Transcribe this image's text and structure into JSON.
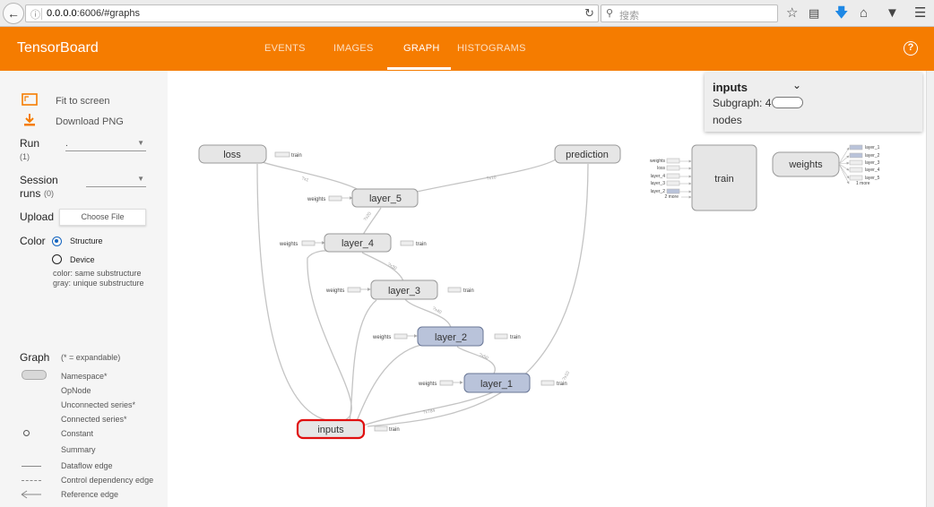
{
  "browser": {
    "url_host": "0.0.0.0",
    "url_rest": ":6006/#graphs",
    "search_placeholder": "搜索"
  },
  "header": {
    "title": "TensorBoard",
    "tabs": [
      {
        "label": "EVENTS"
      },
      {
        "label": "IMAGES"
      },
      {
        "label": "GRAPH"
      },
      {
        "label": "HISTOGRAMS"
      }
    ],
    "active_tab": "GRAPH",
    "help": "?"
  },
  "sidebar": {
    "fit_label": "Fit to screen",
    "download_label": "Download PNG",
    "run_label": "Run",
    "run_count": "(1)",
    "run_value": ".",
    "session_label_1": "Session",
    "session_label_2": "runs",
    "session_count": "(0)",
    "upload_label": "Upload",
    "choose_file": "Choose File",
    "color_label": "Color",
    "color_structure": "Structure",
    "color_device": "Device",
    "color_note_1": "color: same substructure",
    "color_note_2": "gray: unique substructure",
    "graph_label": "Graph",
    "graph_note": "(* = expandable)",
    "legend": [
      "Namespace*",
      "OpNode",
      "Unconnected series*",
      "Connected series*",
      "Constant",
      "Summary",
      "Dataflow edge",
      "Control dependency edge",
      "Reference edge"
    ]
  },
  "infocard": {
    "name": "inputs",
    "subgraph_label": "Subgraph: 4",
    "nodes_label": "nodes"
  },
  "graph": {
    "nodes": {
      "loss": "loss",
      "prediction": "prediction",
      "layer_5": "layer_5",
      "layer_4": "layer_4",
      "layer_3": "layer_3",
      "layer_2": "layer_2",
      "layer_1": "layer_1",
      "inputs": "inputs",
      "train": "train",
      "weights": "weights"
    },
    "aux_labels": {
      "weights": "weights",
      "train": "train"
    },
    "train_inputs": [
      "weights",
      "loss",
      "layer_4",
      "layer_3",
      "layer_2",
      "2 more"
    ],
    "weights_outputs": [
      "layer_1",
      "layer_2",
      "layer_3",
      "layer_4",
      "layer_5",
      "1 more"
    ],
    "edge_labels": [
      "?x1",
      "?x10",
      "?x20",
      "?x30",
      "?x40",
      "?x50",
      "?x784",
      "?x10"
    ]
  },
  "colors": {
    "accent": "#f57c00",
    "node_gray": "#e0e0e0",
    "node_blue": "#b9c3da",
    "selected": "#e01010"
  }
}
